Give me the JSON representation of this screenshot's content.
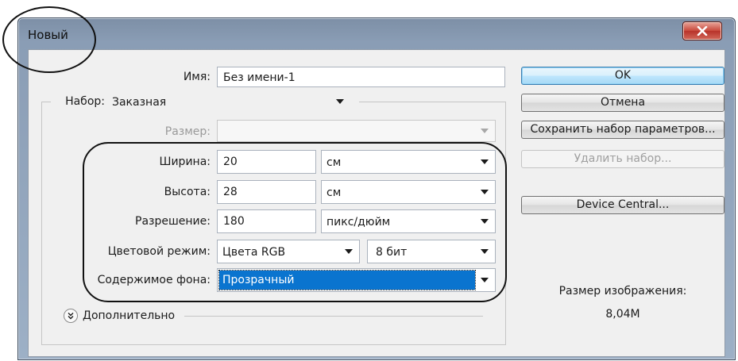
{
  "window": {
    "title": "Новый"
  },
  "form": {
    "name_label": "Имя:",
    "name_value": "Без имени-1",
    "preset_label": "Набор:",
    "preset_value": "Заказная",
    "size_label": "Размер:",
    "size_value": "",
    "width_label": "Ширина:",
    "width_value": "20",
    "width_unit": "см",
    "height_label": "Высота:",
    "height_value": "28",
    "height_unit": "см",
    "resolution_label": "Разрешение:",
    "resolution_value": "180",
    "resolution_unit": "пикс/дюйм",
    "color_mode_label": "Цветовой режим:",
    "color_mode_value": "Цвета RGB",
    "bit_depth_value": "8 бит",
    "background_label": "Содержимое фона:",
    "background_value": "Прозрачный",
    "advanced_label": "Дополнительно"
  },
  "buttons": {
    "ok": "OK",
    "cancel": "Отмена",
    "save_preset": "Сохранить набор параметров...",
    "delete_preset": "Удалить набор...",
    "device_central": "Device Central..."
  },
  "image_size": {
    "label": "Размер изображения:",
    "value": "8,04M"
  },
  "colors": {
    "selection": "#0a74cf",
    "title_bar": "#8a9db5",
    "close_button": "#c8473a"
  }
}
